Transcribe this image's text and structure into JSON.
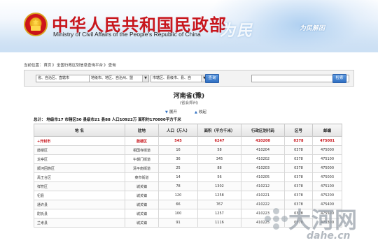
{
  "header": {
    "title_cn": "中华人民共和国民政部",
    "title_en": "Ministry of Civil Affairs of the People's Republic of China",
    "slogan": "为民",
    "slogan_small": "为民解困"
  },
  "breadcrumb": [
    "当前位置：",
    "首页",
    "》",
    "全国行政区划信息查询平台",
    "》",
    "查询"
  ],
  "search": {
    "select1": "省、自治区、直辖市",
    "select2": "地级市、地区、自治州、盟",
    "select3": "市辖区、县级市、县、自",
    "search_btn": "查询",
    "keyword_value": "",
    "search_btn2": "检索"
  },
  "province": {
    "name": "河南省(豫)",
    "capital": "(省会郑州)",
    "expand": "展开",
    "collapse": "收起",
    "summary": "总计：  地级市17  市辖区50  县级市21  县88  人口10922万  面积约170000平方千米"
  },
  "table": {
    "headers": [
      "地  名",
      "驻地",
      "人口（万人）",
      "面积（平方千米）",
      "行政区划代码",
      "区号",
      "邮编"
    ],
    "rows": [
      [
        "+开封市",
        "鼓楼区",
        "545",
        "6247",
        "410200",
        "0378",
        "475001"
      ],
      [
        "鼓楼区",
        "相国寺街道",
        "16",
        "58",
        "410204",
        "0378",
        "475000"
      ],
      [
        "龙亭区",
        "午朝门街道",
        "36",
        "345",
        "410202",
        "0378",
        "475100"
      ],
      [
        "顺河回族区",
        "清平南街道",
        "25",
        "88",
        "410203",
        "0378",
        "475000"
      ],
      [
        "禹王台区",
        "菜市街道",
        "14",
        "56",
        "410205",
        "0378",
        "475003"
      ],
      [
        "祥符区",
        "城关镇",
        "78",
        "1302",
        "410212",
        "0378",
        "475100"
      ],
      [
        "杞县",
        "城关镇",
        "120",
        "1258",
        "410221",
        "0378",
        "475200"
      ],
      [
        "通许县",
        "城关镇",
        "66",
        "767",
        "410222",
        "0378",
        "475400"
      ],
      [
        "尉氏县",
        "城关镇",
        "100",
        "1257",
        "410223",
        "0378",
        "475500"
      ],
      [
        "兰考县",
        "城关镇",
        "91",
        "1116",
        "410225",
        "0378",
        "475300"
      ]
    ]
  },
  "watermark": {
    "big": "大河网",
    "small": "dahe.cn"
  },
  "colors": {
    "brand_red": "#c8161d",
    "button_blue": "#2f6fc2"
  }
}
